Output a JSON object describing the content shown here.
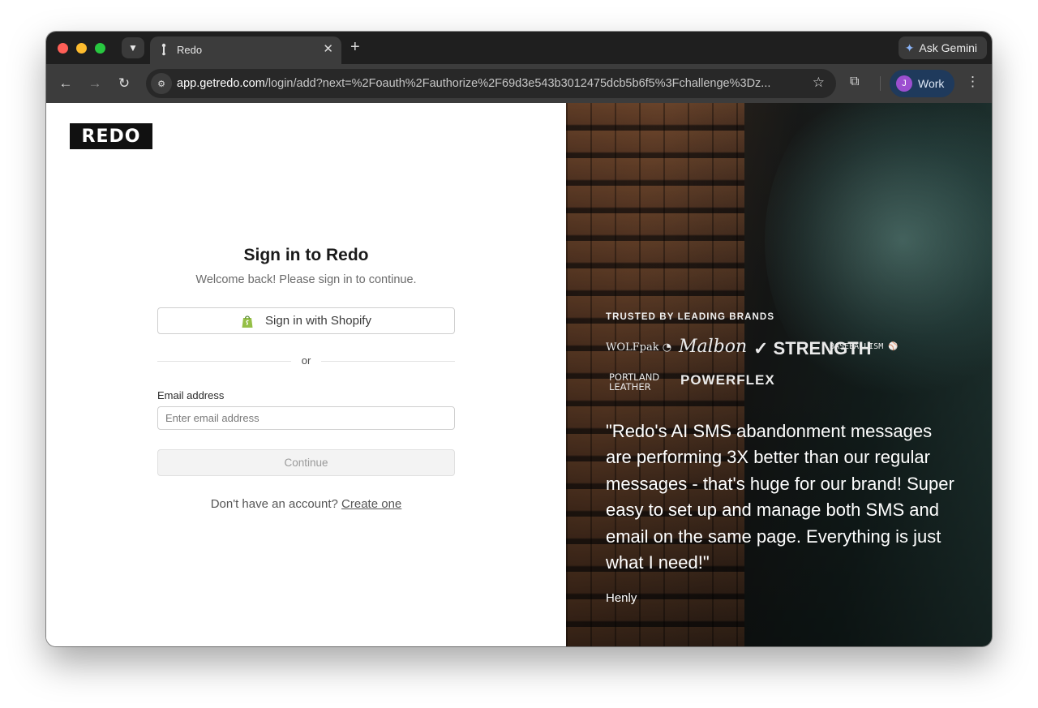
{
  "browser": {
    "tab_title": "Redo",
    "tab_close_glyph": "✕",
    "new_tab_glyph": "+",
    "gemini_label": "Ask Gemini",
    "url_host": "app.getredo.com",
    "url_rest": "/login/add?next=%2Foauth%2Fauthorize%2F69d3e543b3012475dcb5b6f5%3Fchallenge%3Dz...",
    "profile_initial": "J",
    "profile_label": "Work",
    "icons": {
      "tab_search": "chevron-down-icon",
      "back": "arrow-left-icon",
      "forward": "arrow-right-icon",
      "reload": "reload-icon",
      "site_info": "site-settings-icon",
      "bookmark": "star-icon",
      "extensions": "puzzle-icon",
      "menu": "kebab-menu-icon"
    }
  },
  "page": {
    "logo_text": "REDO",
    "title": "Sign in to Redo",
    "subtitle": "Welcome back! Please sign in to continue.",
    "shopify_button": "Sign in with Shopify",
    "divider_text": "or",
    "email_label": "Email address",
    "email_placeholder": "Enter email address",
    "email_value": "",
    "continue_button": "Continue",
    "signup_prompt": "Don't have an account?",
    "signup_link": "Create one"
  },
  "testimonial": {
    "trusted_label": "TRUSTED BY LEADING BRANDS",
    "brands": [
      "WOLFpak",
      "Malbon",
      "Nike Strength",
      "BASEBALLISM",
      "PORTLAND LEATHER",
      "POWERFLEX"
    ],
    "brand_text": {
      "wolfpak": "WOLFpak ◔",
      "malbon": "Malbon",
      "nike": "✓ STRENGTH",
      "baseballism": "BASEBALLISM ⚾",
      "portland_line1": "PORTLAND",
      "portland_line2": "LEATHER",
      "powerflex": "POWERFLEX"
    },
    "quote": "\"Redo's AI SMS abandonment messages are performing 3X better than our regular messages - that's huge for our brand! Super easy to set up and manage both SMS and email on the same page. Everything is just what I need!\"",
    "author": "Henly"
  },
  "colors": {
    "shopify_green": "#95bf47",
    "profile_bg": "#1f3a5c",
    "avatar_bg": "#9c4fd0"
  }
}
